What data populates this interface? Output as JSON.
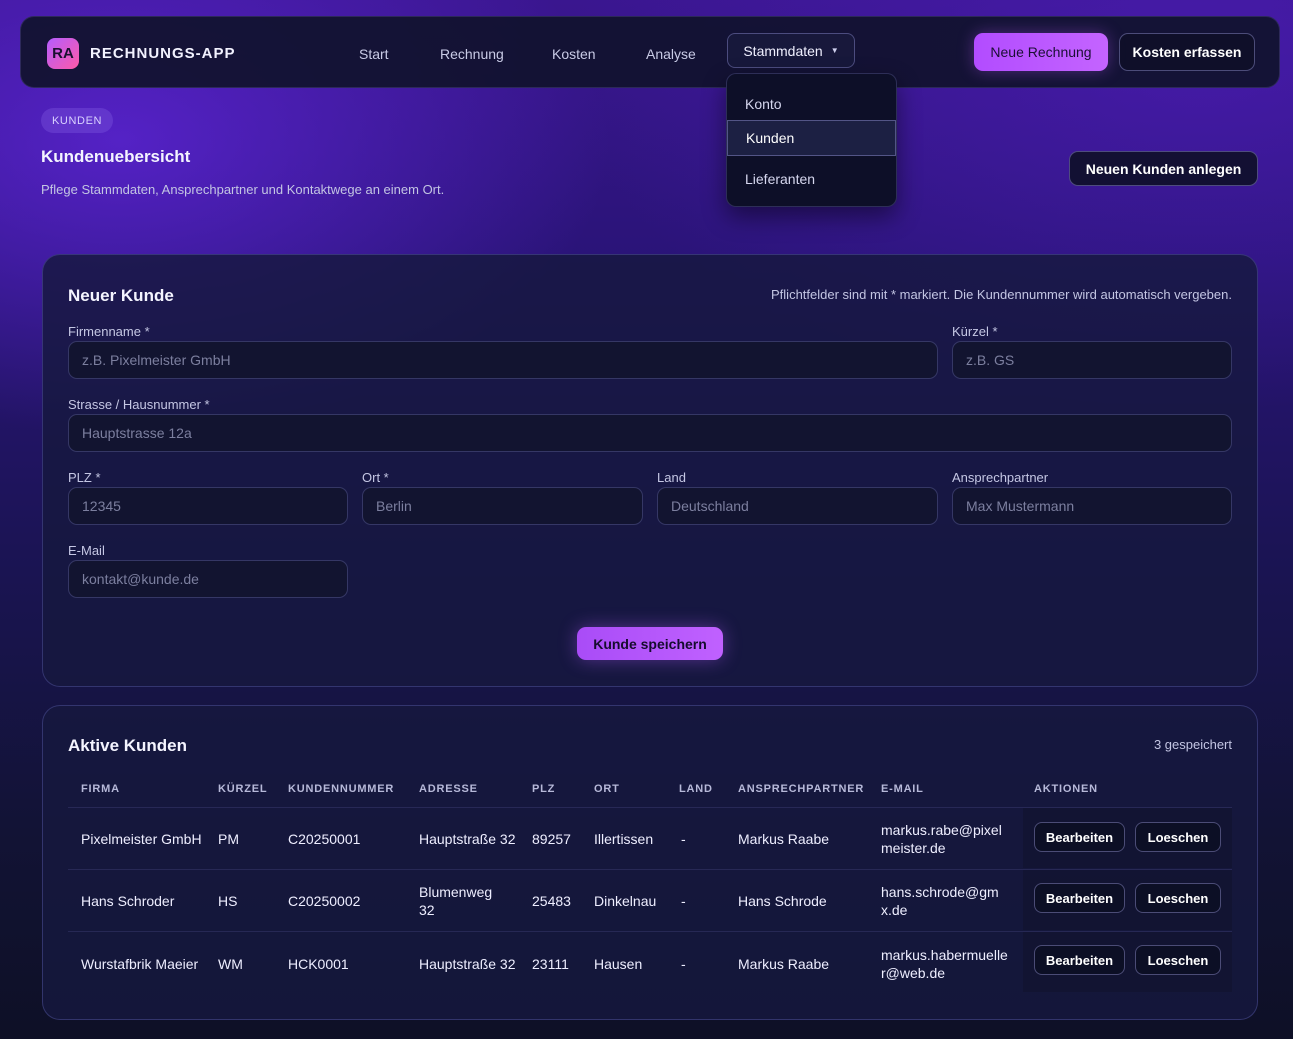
{
  "app": {
    "logo": "RA",
    "title": "RECHNUNGS-APP"
  },
  "nav": {
    "links": [
      "Start",
      "Rechnung",
      "Kosten",
      "Analyse"
    ],
    "stammdaten": "Stammdaten",
    "new_invoice": "Neue Rechnung",
    "add_costs": "Kosten erfassen",
    "dropdown": [
      "Konto",
      "Kunden",
      "Lieferanten"
    ],
    "dropdown_active": "Kunden"
  },
  "header": {
    "crumb": "KUNDEN",
    "title": "Kundenuebersicht",
    "subtitle": "Pflege Stammdaten, Ansprechpartner und Kontaktwege an einem Ort.",
    "new_customer": "Neuen Kunden anlegen"
  },
  "form": {
    "title": "Neuer Kunde",
    "note": "Pflichtfelder sind mit * markiert. Die Kundennummer wird automatisch vergeben.",
    "fields": {
      "company": {
        "label": "Firmenname *",
        "placeholder": "z.B. Pixelmeister GmbH"
      },
      "short": {
        "label": "Kürzel *",
        "placeholder": "z.B. GS"
      },
      "street": {
        "label": "Strasse / Hausnummer *",
        "placeholder": "Hauptstrasse 12a"
      },
      "zip": {
        "label": "PLZ *",
        "placeholder": "12345"
      },
      "city": {
        "label": "Ort *",
        "placeholder": "Berlin"
      },
      "country": {
        "label": "Land",
        "placeholder": "Deutschland"
      },
      "contact": {
        "label": "Ansprechpartner",
        "placeholder": "Max Mustermann"
      },
      "email": {
        "label": "E-Mail",
        "placeholder": "kontakt@kunde.de"
      }
    },
    "save": "Kunde speichern"
  },
  "table": {
    "title": "Aktive Kunden",
    "count": "3 gespeichert",
    "headers": [
      "FIRMA",
      "KÜRZEL",
      "KUNDENNUMMER",
      "ADRESSE",
      "PLZ",
      "ORT",
      "LAND",
      "ANSPRECHPARTNER",
      "E-MAIL",
      "AKTIONEN"
    ],
    "edit_label": "Bearbeiten",
    "delete_label": "Loeschen",
    "rows": [
      {
        "firma": "Pixelmeister GmbH",
        "kuerzel": "PM",
        "nr": "C20250001",
        "adresse": "Hauptstraße 32",
        "plz": "89257",
        "ort": "Illertissen",
        "land": "-",
        "ansprech": "Markus Raabe",
        "email": "markus.rabe@pixelmeister.de"
      },
      {
        "firma": "Hans Schroder",
        "kuerzel": "HS",
        "nr": "C20250002",
        "adresse": "Blumenweg 32",
        "plz": "25483",
        "ort": "Dinkelnau",
        "land": "-",
        "ansprech": "Hans Schrode",
        "email": "hans.schrode@gmx.de"
      },
      {
        "firma": "Wurstafbrik Maeier",
        "kuerzel": "WM",
        "nr": "HCK0001",
        "adresse": "Hauptstraße 32",
        "plz": "23111",
        "ort": "Hausen",
        "land": "-",
        "ansprech": "Markus Raabe",
        "email": "markus.habermueller@web.de"
      }
    ]
  }
}
